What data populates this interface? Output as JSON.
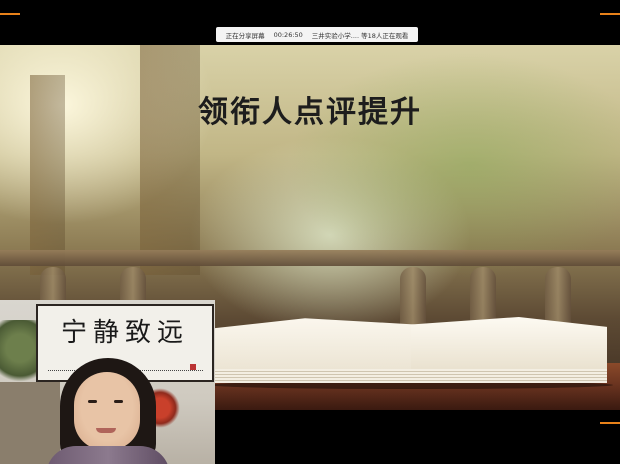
{
  "share_bar": {
    "sharing_label": "正在分享屏幕",
    "timer": "00:26:50",
    "viewers_label": "三井实验小学.... 等18人正在观看"
  },
  "slide": {
    "title": "领衔人点评提升"
  },
  "webcam": {
    "calligraphy_text": "宁静致远"
  },
  "colors": {
    "accent": "#e8821a",
    "title": "#1d1d1d"
  }
}
